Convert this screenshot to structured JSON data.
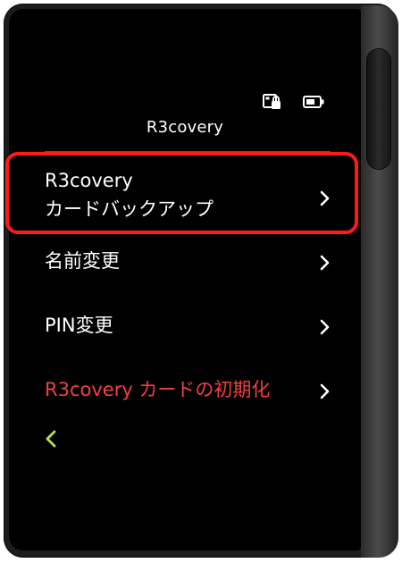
{
  "screen": {
    "title": "R3covery"
  },
  "status_icons": [
    "card-lock-icon",
    "battery-icon"
  ],
  "menu": {
    "items": [
      {
        "lines": [
          "R3covery",
          "カードバックアップ"
        ],
        "icon": "chevron-right-icon"
      },
      {
        "label": "名前変更",
        "icon": "chevron-right-icon"
      },
      {
        "label": "PIN変更",
        "icon": "chevron-right-icon"
      },
      {
        "label": "R3covery カードの初期化",
        "icon": "chevron-right-icon",
        "color": "#f0413f"
      }
    ]
  },
  "back": {
    "icon": "chevron-left-icon",
    "color": "#b5e24a"
  },
  "highlight": {
    "color": "#ff1a1a"
  }
}
